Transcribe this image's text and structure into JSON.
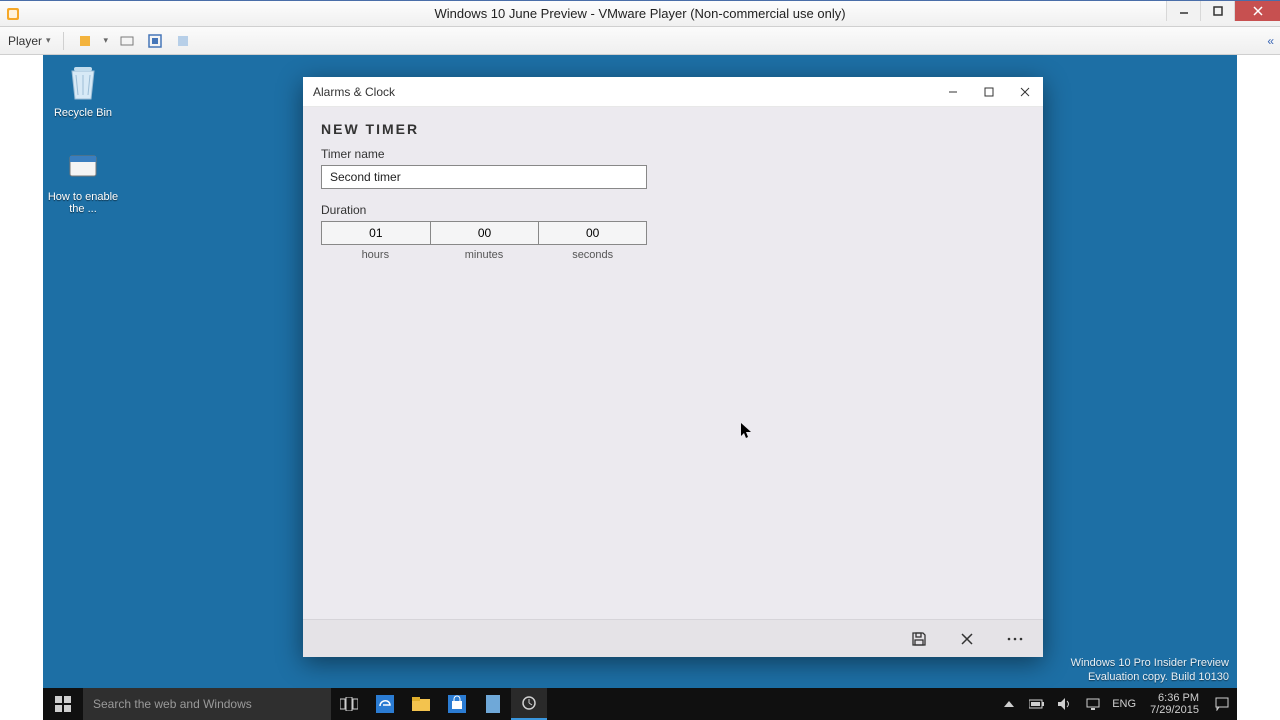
{
  "host": {
    "title": "Windows 10 June Preview - VMware Player (Non-commercial use only)",
    "player_menu": "Player",
    "collapse_glyph": "«"
  },
  "desktop": {
    "icons": {
      "recycle_bin": "Recycle Bin",
      "howto": "How to enable the ..."
    },
    "watermark": {
      "line1": "Windows 10 Pro Insider Preview",
      "line2": "Evaluation copy. Build 10130"
    }
  },
  "taskbar": {
    "search_placeholder": "Search the web and Windows",
    "lang": "ENG",
    "time": "6:36 PM",
    "date": "7/29/2015"
  },
  "app": {
    "title": "Alarms & Clock",
    "heading": "NEW TIMER",
    "labels": {
      "timer_name": "Timer name",
      "duration": "Duration",
      "hours": "hours",
      "minutes": "minutes",
      "seconds": "seconds"
    },
    "values": {
      "timer_name": "Second timer",
      "hours": "01",
      "minutes": "00",
      "seconds": "00"
    }
  }
}
